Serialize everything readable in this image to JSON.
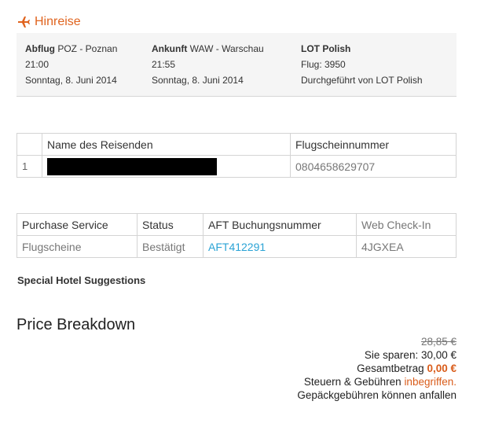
{
  "outbound": {
    "title": "Hinreise",
    "departure": {
      "label": "Abflug",
      "place": "POZ - Poznan",
      "time": "21:00",
      "date": "Sonntag, 8. Juni 2014"
    },
    "arrival": {
      "label": "Ankunft",
      "place": "WAW - Warschau",
      "time": "21:55",
      "date": "Sonntag, 8. Juni 2014"
    },
    "airline": {
      "name": "LOT Polish",
      "flight": "Flug: 3950",
      "operated": "Durchgeführt von LOT Polish"
    }
  },
  "travelers": {
    "headers": [
      "Name des Reisenden",
      "Flugscheinnummer"
    ],
    "rows": [
      {
        "index": "1",
        "ticket": "0804658629707"
      }
    ]
  },
  "services": {
    "headers": [
      "Purchase Service",
      "Status",
      "AFT Buchungsnummer",
      "Web Check-In"
    ],
    "rows": [
      {
        "service": "Flugscheine",
        "status": "Bestätigt",
        "booking": "AFT412291",
        "checkin": "4JGXEA"
      }
    ]
  },
  "hotel_heading": "Special Hotel Suggestions",
  "price": {
    "title": "Price Breakdown",
    "original": "28,85 €",
    "savings": "Sie sparen: 30,00 €",
    "total_label": "Gesamtbetrag",
    "total_value": "0,00 €",
    "taxes_label": "Steuern & Gebühren",
    "taxes_value": "inbegriffen.",
    "baggage": "Gepäckgebühren können anfallen"
  },
  "colors": {
    "accent": "#e0641f",
    "link": "#2aa3d5",
    "panel": "#f5f5f5"
  },
  "icons": {
    "flight": "airplane-icon"
  }
}
